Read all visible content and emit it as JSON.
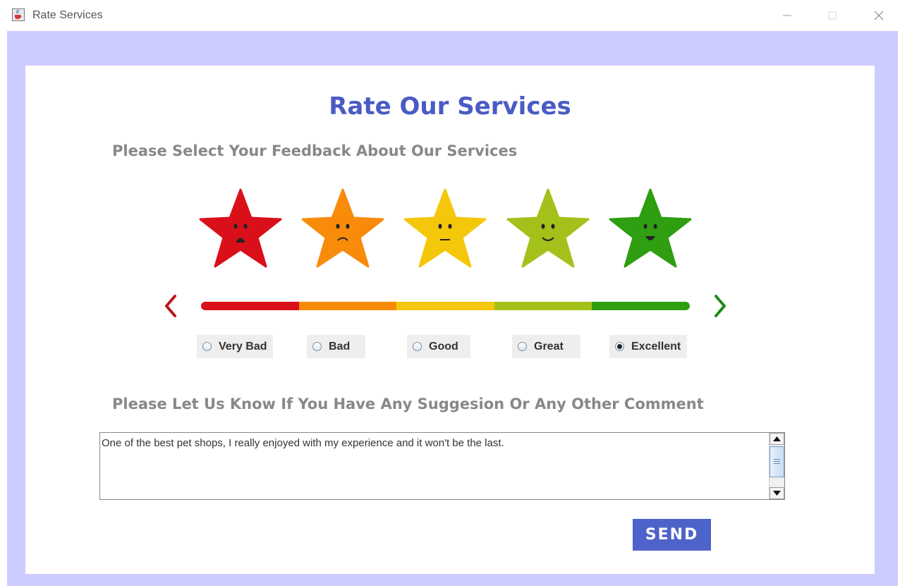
{
  "window": {
    "title": "Rate Services",
    "icon": "java-cup-icon"
  },
  "header": {
    "title": "Rate Our Services",
    "feedback_prompt": "Please Select Your Feedback About Our Services",
    "comment_prompt": "Please Let  Us Know If You Have Any Suggesion Or Any Other Comment"
  },
  "ratings": [
    {
      "label": "Very Bad",
      "color": "#d9101a",
      "selected": false
    },
    {
      "label": "Bad",
      "color": "#f98b0a",
      "selected": false
    },
    {
      "label": "Good",
      "color": "#f5c70b",
      "selected": false
    },
    {
      "label": "Great",
      "color": "#a3c11a",
      "selected": false
    },
    {
      "label": "Excellent",
      "color": "#2f9e11",
      "selected": true
    }
  ],
  "colors": {
    "title": "#4a5bc4",
    "background": "#ccccff",
    "left_arrow": "#b8161c",
    "right_arrow": "#1f8a1a",
    "send_button": "#4e63c9"
  },
  "comment": {
    "value": "One of the best pet shops, I really enjoyed with my experience and it won't be the last."
  },
  "send_button": {
    "label": "SEND"
  }
}
